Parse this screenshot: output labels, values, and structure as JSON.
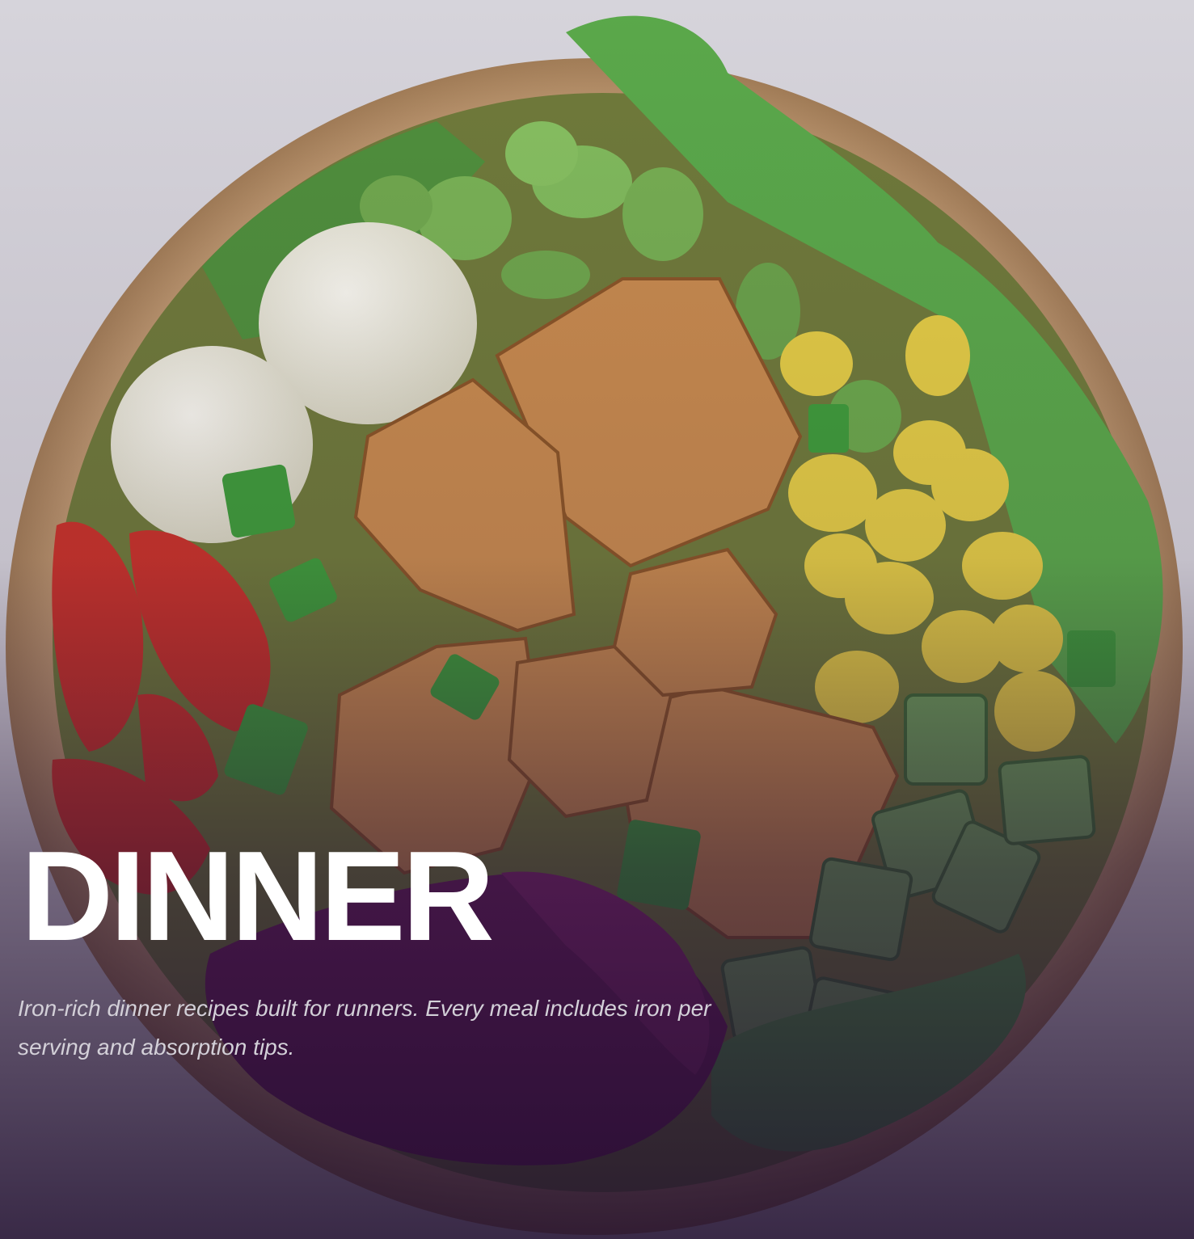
{
  "hero": {
    "title": "DINNER",
    "subtitle": "Iron-rich dinner recipes built for runners. Every meal includes iron per serving and absorption tips."
  },
  "colors": {
    "title_text": "#ffffff",
    "subtitle_text": "#d3d0d8",
    "overlay_tint": "#2a1c35"
  }
}
